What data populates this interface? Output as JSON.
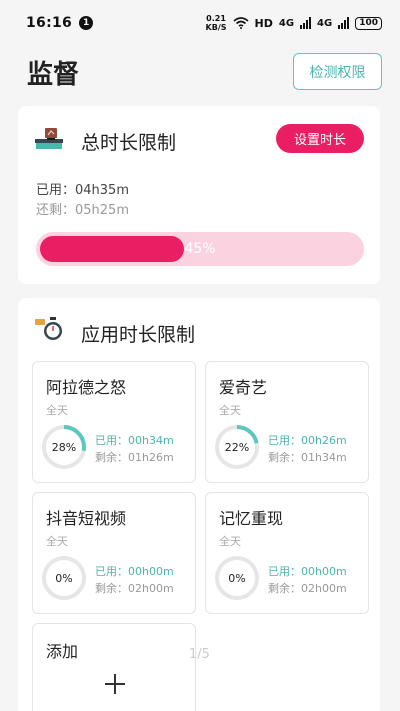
{
  "status_bar": {
    "time": "16:16",
    "notification_count": "1",
    "net_speed_value": "0.21",
    "net_speed_unit": "KB/S",
    "hd_label": "HD",
    "sim1_label": "4G",
    "sim2_label": "4G",
    "battery": "100"
  },
  "header": {
    "title": "监督",
    "check_permission_label": "检测权限"
  },
  "total_limit": {
    "icon": "desk-icon",
    "title": "总时长限制",
    "set_button_label": "设置时长",
    "used_text": "已用：04h35m",
    "remaining_text": "还剩：05h25m",
    "progress_percent": 45,
    "progress_label": "45%"
  },
  "app_limits": {
    "icon": "stopwatch-icon",
    "title": "应用时长限制",
    "apps": [
      {
        "name": "阿拉德之怒",
        "period": "全天",
        "percent": 28,
        "percent_label": "28%",
        "used": "已用：00h34m",
        "remaining": "剩余：01h26m"
      },
      {
        "name": "爱奇艺",
        "period": "全天",
        "percent": 22,
        "percent_label": "22%",
        "used": "已用：00h26m",
        "remaining": "剩余：01h34m"
      },
      {
        "name": "抖音短视频",
        "period": "全天",
        "percent": 0,
        "percent_label": "0%",
        "used": "已用：00h00m",
        "remaining": "剩余：02h00m"
      },
      {
        "name": "记忆重现",
        "period": "全天",
        "percent": 0,
        "percent_label": "0%",
        "used": "已用：00h00m",
        "remaining": "剩余：02h00m"
      }
    ],
    "add_label": "添加"
  },
  "page_indicator": "1/5",
  "colors": {
    "accent_pink": "#e91e63",
    "accent_teal": "#5ec6c0",
    "ring_track": "#e6e6e6"
  }
}
